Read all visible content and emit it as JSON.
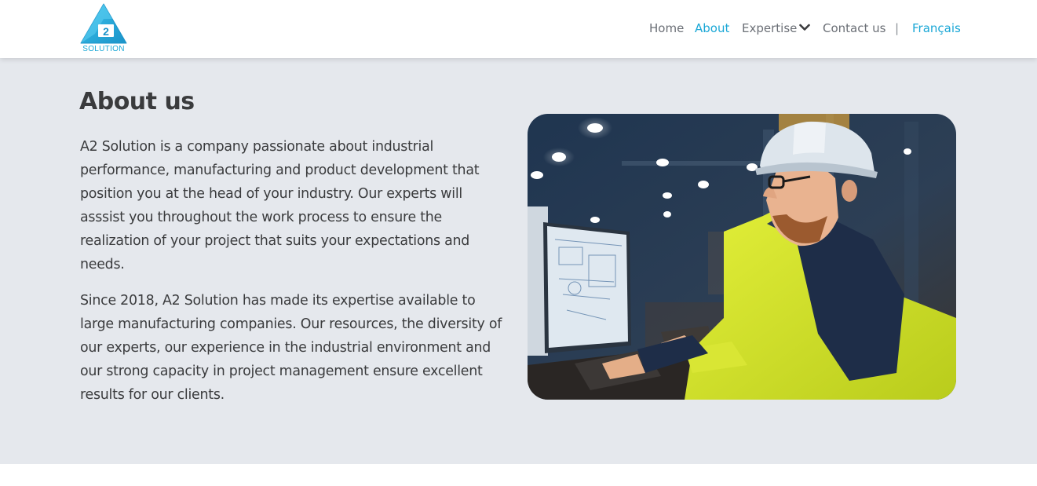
{
  "header": {
    "logo": {
      "text": "SOLUTION",
      "mark": "A2",
      "icon": "a2-triangle-logo"
    },
    "nav": {
      "home": "Home",
      "about": "About",
      "expertise": "Expertise",
      "contact": "Contact us",
      "separator": "|",
      "language": "Français"
    }
  },
  "about": {
    "title": "About us",
    "paragraph1": "A2 Solution is a company passionate about industrial performance, manufacturing and product development that position you at the head of your industry. Our experts will asssist you throughout the work process to ensure the realization of your project that suits your expectations and needs.",
    "paragraph2": "Since 2018, A2 Solution has made its expertise available to large manufacturing companies. Our resources, the diversity of our experts, our experience in the industrial environment and our strong capacity in project management ensure excellent results for our clients.",
    "image": "engineer-at-computer-photo"
  },
  "colors": {
    "accent": "#1aa7d6",
    "section_bg": "#e5e8ed",
    "text": "#3a3b3d",
    "nav_text": "#6b6f76"
  }
}
